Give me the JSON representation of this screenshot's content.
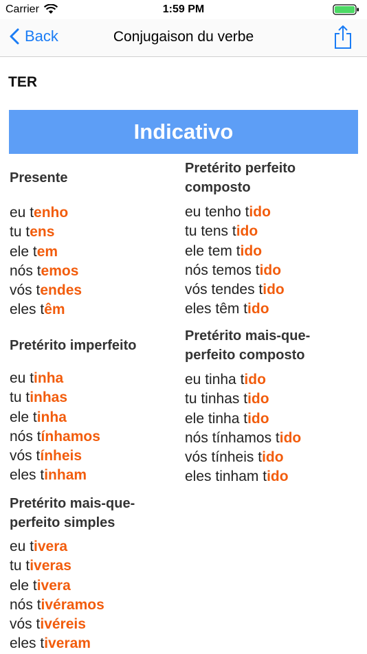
{
  "status": {
    "carrier": "Carrier",
    "time": "1:59 PM"
  },
  "nav": {
    "back_label": "Back",
    "title": "Conjugaison du verbe"
  },
  "verb": "TER",
  "mood_banner": "Indicativo",
  "colors": {
    "accent": "#1a7cf5",
    "banner": "#5d9ef6",
    "ending": "#f25c0c"
  },
  "tenses": {
    "presente": {
      "name": "Presente",
      "forms": [
        {
          "stem": "eu t",
          "ending": "enho"
        },
        {
          "stem": "tu t",
          "ending": "ens"
        },
        {
          "stem": "ele t",
          "ending": "em"
        },
        {
          "stem": "nós t",
          "ending": "emos"
        },
        {
          "stem": "vós t",
          "ending": "endes"
        },
        {
          "stem": "eles t",
          "ending": "êm"
        }
      ]
    },
    "perfeito_composto": {
      "name": "Pretérito perfeito composto",
      "forms": [
        {
          "stem": "eu tenho t",
          "ending": "ido"
        },
        {
          "stem": "tu tens t",
          "ending": "ido"
        },
        {
          "stem": "ele tem t",
          "ending": "ido"
        },
        {
          "stem": "nós temos t",
          "ending": "ido"
        },
        {
          "stem": "vós tendes t",
          "ending": "ido"
        },
        {
          "stem": "eles têm t",
          "ending": "ido"
        }
      ]
    },
    "imperfeito": {
      "name": "Pretérito imperfeito",
      "forms": [
        {
          "stem": "eu t",
          "ending": "inha"
        },
        {
          "stem": "tu t",
          "ending": "inhas"
        },
        {
          "stem": "ele t",
          "ending": "inha"
        },
        {
          "stem": "nós t",
          "ending": "ínhamos"
        },
        {
          "stem": "vós t",
          "ending": "ínheis"
        },
        {
          "stem": "eles t",
          "ending": "inham"
        }
      ]
    },
    "mais_que_perfeito_composto": {
      "name": "Pretérito mais-que-perfeito composto",
      "forms": [
        {
          "stem": "eu tinha t",
          "ending": "ido"
        },
        {
          "stem": "tu tinhas t",
          "ending": "ido"
        },
        {
          "stem": "ele tinha t",
          "ending": "ido"
        },
        {
          "stem": "nós tínhamos t",
          "ending": "ido"
        },
        {
          "stem": "vós tínheis t",
          "ending": "ido"
        },
        {
          "stem": "eles tinham t",
          "ending": "ido"
        }
      ]
    },
    "mais_que_perfeito_simples": {
      "name": "Pretérito mais-que-perfeito simples",
      "forms": [
        {
          "stem": "eu t",
          "ending": "ivera"
        },
        {
          "stem": "tu t",
          "ending": "iveras"
        },
        {
          "stem": "ele t",
          "ending": "ivera"
        },
        {
          "stem": "nós t",
          "ending": "ivéramos"
        },
        {
          "stem": "vós t",
          "ending": "ivéreis"
        },
        {
          "stem": "eles t",
          "ending": "iveram"
        }
      ]
    }
  }
}
